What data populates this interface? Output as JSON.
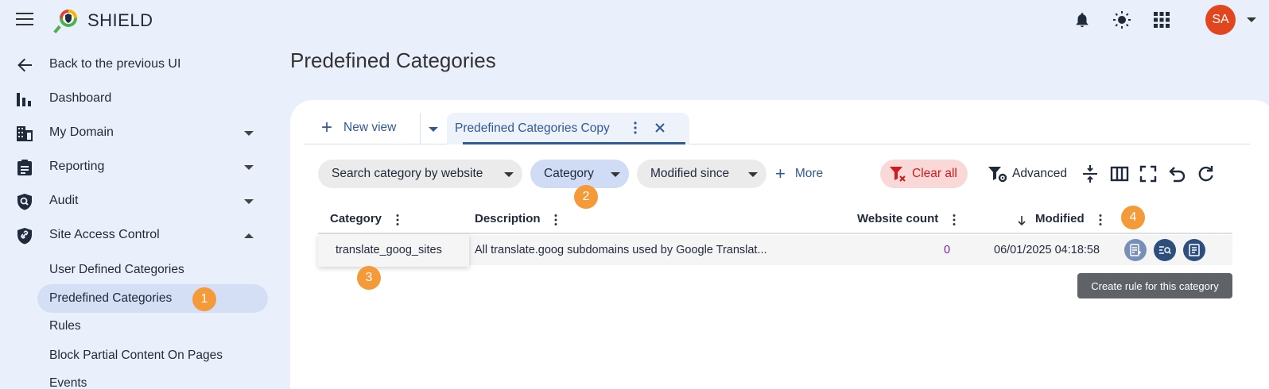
{
  "app": {
    "brand": "SHIELD"
  },
  "user": {
    "initials": "SA",
    "avatar_color": "#e2461f"
  },
  "sidebar": {
    "back": "Back to the previous UI",
    "items": [
      {
        "label": "Dashboard",
        "icon": "bar-chart-icon"
      },
      {
        "label": "My Domain",
        "icon": "building-icon"
      },
      {
        "label": "Reporting",
        "icon": "clipboard-icon"
      },
      {
        "label": "Audit",
        "icon": "shield-search-icon"
      },
      {
        "label": "Site Access Control",
        "icon": "shield-link-icon"
      }
    ],
    "sub_items": [
      {
        "label": "User Defined Categories"
      },
      {
        "label": "Predefined Categories"
      },
      {
        "label": "Rules"
      },
      {
        "label": "Block Partial Content On Pages"
      },
      {
        "label": "Events"
      }
    ]
  },
  "page": {
    "title": "Predefined Categories"
  },
  "tabs": {
    "new_view": "New view",
    "active_tab": "Predefined Categories Copy"
  },
  "filters": {
    "search": "Search category by website",
    "category": "Category",
    "modified_since": "Modified since",
    "more": "More",
    "clear_all": "Clear all",
    "advanced": "Advanced"
  },
  "table": {
    "columns": [
      "Category",
      "Description",
      "Website count",
      "Modified"
    ],
    "rows": [
      {
        "category": "translate_goog_sites",
        "description": "All translate.goog subdomains used by Google Translat...",
        "website_count": "0",
        "modified": "06/01/2025 04:18:58"
      }
    ]
  },
  "tooltip": "Create rule for this category",
  "badges": [
    "1",
    "2",
    "3",
    "4"
  ],
  "colors": {
    "accent": "#2f5a96",
    "badge": "#f59a38",
    "clear": "#d11a1a",
    "count": "#7b1fa2"
  }
}
